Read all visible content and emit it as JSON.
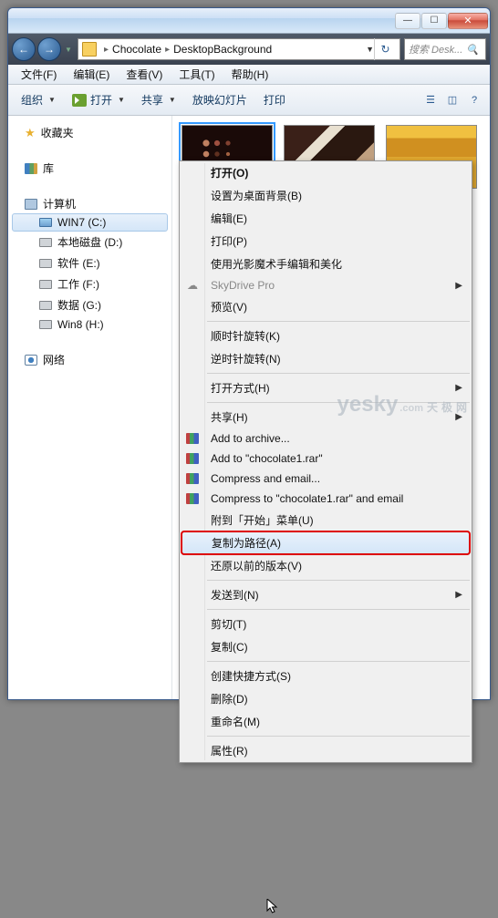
{
  "titlebar": {
    "min": "—",
    "max": "☐",
    "close": "✕"
  },
  "address": {
    "back": "←",
    "fwd": "→",
    "dd": "▼",
    "crumbs": [
      "Chocolate",
      "DesktopBackground"
    ],
    "sep": "▸",
    "refresh": "↻",
    "search_placeholder": "搜索 Desk...",
    "search_icon": "🔍"
  },
  "menubar": [
    "文件(F)",
    "编辑(E)",
    "查看(V)",
    "工具(T)",
    "帮助(H)"
  ],
  "toolbar": {
    "organize": "组织",
    "open": "打开",
    "share": "共享",
    "slideshow": "放映幻灯片",
    "print": "打印",
    "dd": "▼"
  },
  "sidebar": {
    "fav": "收藏夹",
    "lib": "库",
    "pc": "计算机",
    "drives": [
      "WIN7 (C:)",
      "本地磁盘 (D:)",
      "软件 (E:)",
      "工作 (F:)",
      "数据 (G:)",
      "Win8 (H:)"
    ],
    "net": "网络"
  },
  "context_menu": [
    {
      "t": "item",
      "label": "打开(O)",
      "bold": true
    },
    {
      "t": "item",
      "label": "设置为桌面背景(B)"
    },
    {
      "t": "item",
      "label": "编辑(E)"
    },
    {
      "t": "item",
      "label": "打印(P)"
    },
    {
      "t": "item",
      "label": "使用光影魔术手编辑和美化"
    },
    {
      "t": "item",
      "label": "SkyDrive Pro",
      "sub": true,
      "disabled": true,
      "icon": "sdp"
    },
    {
      "t": "item",
      "label": "预览(V)"
    },
    {
      "t": "sep"
    },
    {
      "t": "item",
      "label": "顺时针旋转(K)"
    },
    {
      "t": "item",
      "label": "逆时针旋转(N)"
    },
    {
      "t": "sep"
    },
    {
      "t": "item",
      "label": "打开方式(H)",
      "sub": true
    },
    {
      "t": "sep"
    },
    {
      "t": "item",
      "label": "共享(H)",
      "sub": true
    },
    {
      "t": "item",
      "label": "Add to archive...",
      "icon": "rar"
    },
    {
      "t": "item",
      "label": "Add to \"chocolate1.rar\"",
      "icon": "rar"
    },
    {
      "t": "item",
      "label": "Compress and email...",
      "icon": "rar"
    },
    {
      "t": "item",
      "label": "Compress to \"chocolate1.rar\" and email",
      "icon": "rar"
    },
    {
      "t": "item",
      "label": "附到「开始」菜单(U)"
    },
    {
      "t": "item",
      "label": "复制为路径(A)",
      "hl": true,
      "red": true
    },
    {
      "t": "item",
      "label": "还原以前的版本(V)"
    },
    {
      "t": "sep"
    },
    {
      "t": "item",
      "label": "发送到(N)",
      "sub": true
    },
    {
      "t": "sep"
    },
    {
      "t": "item",
      "label": "剪切(T)"
    },
    {
      "t": "item",
      "label": "复制(C)"
    },
    {
      "t": "sep"
    },
    {
      "t": "item",
      "label": "创建快捷方式(S)"
    },
    {
      "t": "item",
      "label": "删除(D)"
    },
    {
      "t": "item",
      "label": "重命名(M)"
    },
    {
      "t": "sep"
    },
    {
      "t": "item",
      "label": "属性(R)"
    }
  ],
  "watermark": {
    "brand": "yesky",
    "dom": ".com",
    "cn": "天极网"
  }
}
